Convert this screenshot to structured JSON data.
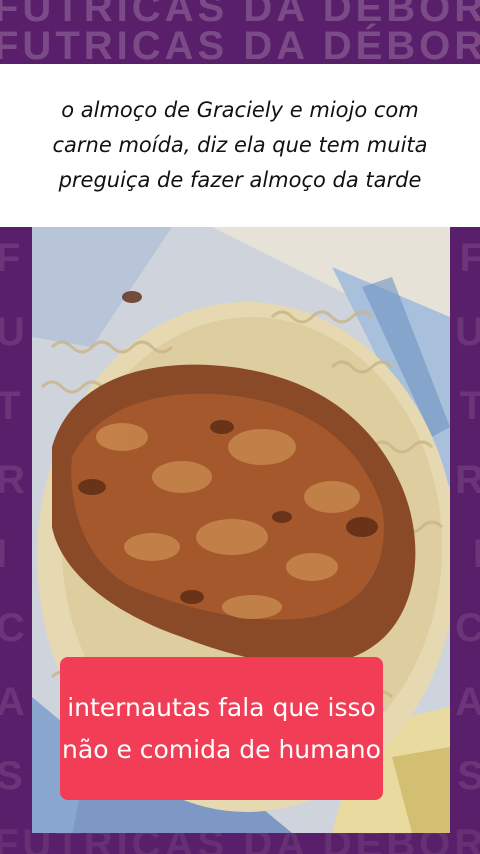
{
  "watermark": {
    "text": "FUTRICAS DA DÉBORA",
    "side_letters": [
      "F",
      "U",
      "T",
      "R",
      "I",
      "C",
      "A",
      "S"
    ]
  },
  "caption": {
    "text": "o almoço de Graciely e miojo com carne moída, diz ela que tem muita preguiça de fazer almoço da tarde"
  },
  "overlay": {
    "text": "internautas fala que isso não e comida de humano"
  },
  "colors": {
    "background": "#5a1f6a",
    "overlay": "#f13d55",
    "caption_background": "#ffffff"
  }
}
